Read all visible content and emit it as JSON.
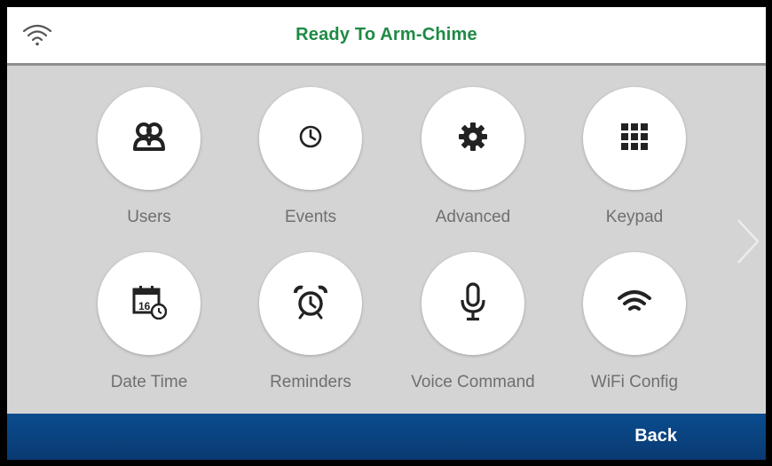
{
  "header": {
    "title": "Ready To Arm-Chime",
    "status_icon": "wifi-signal-icon",
    "title_color": "#1e8a44"
  },
  "menu": {
    "items": [
      {
        "label": "Users",
        "icon": "users-icon"
      },
      {
        "label": "Events",
        "icon": "clock-icon"
      },
      {
        "label": "Advanced",
        "icon": "gear-icon"
      },
      {
        "label": "Keypad",
        "icon": "keypad-icon"
      },
      {
        "label": "Date Time",
        "icon": "calendar-clock-icon"
      },
      {
        "label": "Reminders",
        "icon": "alarm-clock-icon"
      },
      {
        "label": "Voice Command",
        "icon": "microphone-icon"
      },
      {
        "label": "WiFi Config",
        "icon": "wifi-icon"
      }
    ],
    "next_icon": "chevron-right-icon"
  },
  "footer": {
    "back_label": "Back",
    "background": "#0a4c8e"
  }
}
